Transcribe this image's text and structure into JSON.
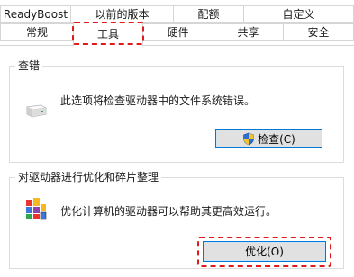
{
  "tabs": {
    "row1": [
      "ReadyBoost",
      "以前的版本",
      "配额",
      "自定义"
    ],
    "row2": [
      "常规",
      "工具",
      "硬件",
      "共享",
      "安全"
    ],
    "selected": "工具"
  },
  "error_checking": {
    "title": "查错",
    "description": "此选项将检查驱动器中的文件系统错误。",
    "button_label": "检查(C)"
  },
  "optimize": {
    "title": "对驱动器进行优化和碎片整理",
    "description": "优化计算机的驱动器可以帮助其更高效运行。",
    "button_label": "优化(O)"
  },
  "colors": {
    "highlight_red": "#e0191a",
    "button_border_blue": "#0078d7",
    "button_face": "#e1e1e1",
    "border_gray": "#d6d6d6"
  },
  "icons": {
    "drive": "drive-icon",
    "shield": "uac-shield-icon",
    "defrag": "defrag-icon"
  }
}
